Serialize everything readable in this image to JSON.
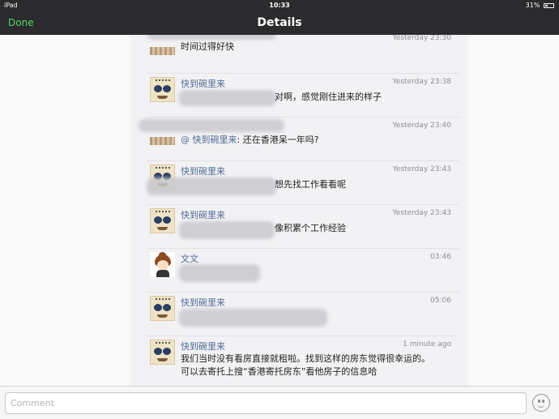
{
  "status_bar": {
    "carrier": "iPad",
    "time": "10:33",
    "battery": "31%",
    "battery_level": 0.31
  },
  "nav": {
    "done_label": "Done",
    "title": "Details"
  },
  "comments": [
    {
      "name": "",
      "time": "Yesterday 23:30",
      "text": "时间过得好快"
    },
    {
      "name": "快到碗里来",
      "time": "Yesterday 23:38",
      "text": "对啊，感觉刚住进来的样子"
    },
    {
      "name": "",
      "time": "Yesterday 23:40",
      "mention": "@ 快到碗里来",
      "text": ": 还在香港呆一年吗?"
    },
    {
      "name": "快到碗里来",
      "time": "Yesterday 23:43",
      "text": "想先找工作看看呢"
    },
    {
      "name": "快到碗里来",
      "time": "Yesterday 23:43",
      "text": "像积累个工作经验"
    },
    {
      "name": "文文",
      "time": "03:46",
      "text": ""
    },
    {
      "name": "快到碗里来",
      "time": "05:06",
      "text": ""
    },
    {
      "name": "快到碗里来",
      "time": "1 minute ago",
      "text": "我们当时没有看房直接就租啦。找到这样的房东觉得很幸运的。",
      "text2": "可以去寄托上搜“香港寄托房东”看他房子的信息哈"
    }
  ],
  "input": {
    "placeholder": "Comment",
    "value": ""
  },
  "icons": {
    "emoji": "smiley-icon",
    "wifi": "wifi-icon"
  }
}
